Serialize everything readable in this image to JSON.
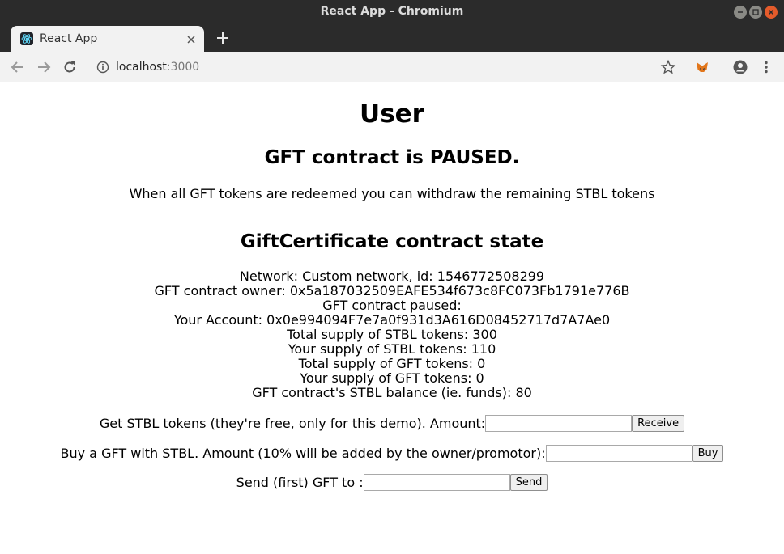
{
  "window": {
    "title": "React App - Chromium"
  },
  "tab": {
    "label": "React App"
  },
  "address_bar": {
    "host": "localhost",
    "port": ":3000"
  },
  "page": {
    "heading": "User",
    "paused_notice": "GFT contract is PAUSED.",
    "withdraw_note": "When all GFT tokens are redeemed you can withdraw the remaining STBL tokens",
    "state_heading": "GiftCertificate contract state",
    "state_lines": [
      "Network: Custom network, id: 1546772508299",
      "GFT contract owner: 0x5a187032509EAFE534f673c8FC073Fb1791e776B",
      "GFT contract paused:",
      "Your Account: 0x0e994094F7e7a0f931d3A616D08452717d7A7Ae0",
      "Total supply of STBL tokens: 300",
      "Your supply of STBL tokens: 110",
      "Total supply of GFT tokens: 0",
      "Your supply of GFT tokens: 0",
      "GFT contract's STBL balance (ie. funds): 80"
    ],
    "receive_form": {
      "label": "Get STBL tokens (they're free, only for this demo). Amount:",
      "value": "",
      "button": "Receive"
    },
    "buy_form": {
      "label": "Buy a GFT with STBL. Amount (10% will be added by the owner/promotor):",
      "value": "",
      "button": "Buy"
    },
    "send_form": {
      "label": "Send (first) GFT to :",
      "value": "",
      "button": "Send"
    }
  },
  "colors": {
    "titlebar": "#2b2b2b",
    "toolbar": "#f2f2f2",
    "close_button": "#e45b2b"
  },
  "icons": [
    "react-favicon",
    "back-icon",
    "forward-icon",
    "reload-icon",
    "info-icon",
    "star-icon",
    "metamask-icon",
    "profile-icon",
    "menu-icon"
  ]
}
